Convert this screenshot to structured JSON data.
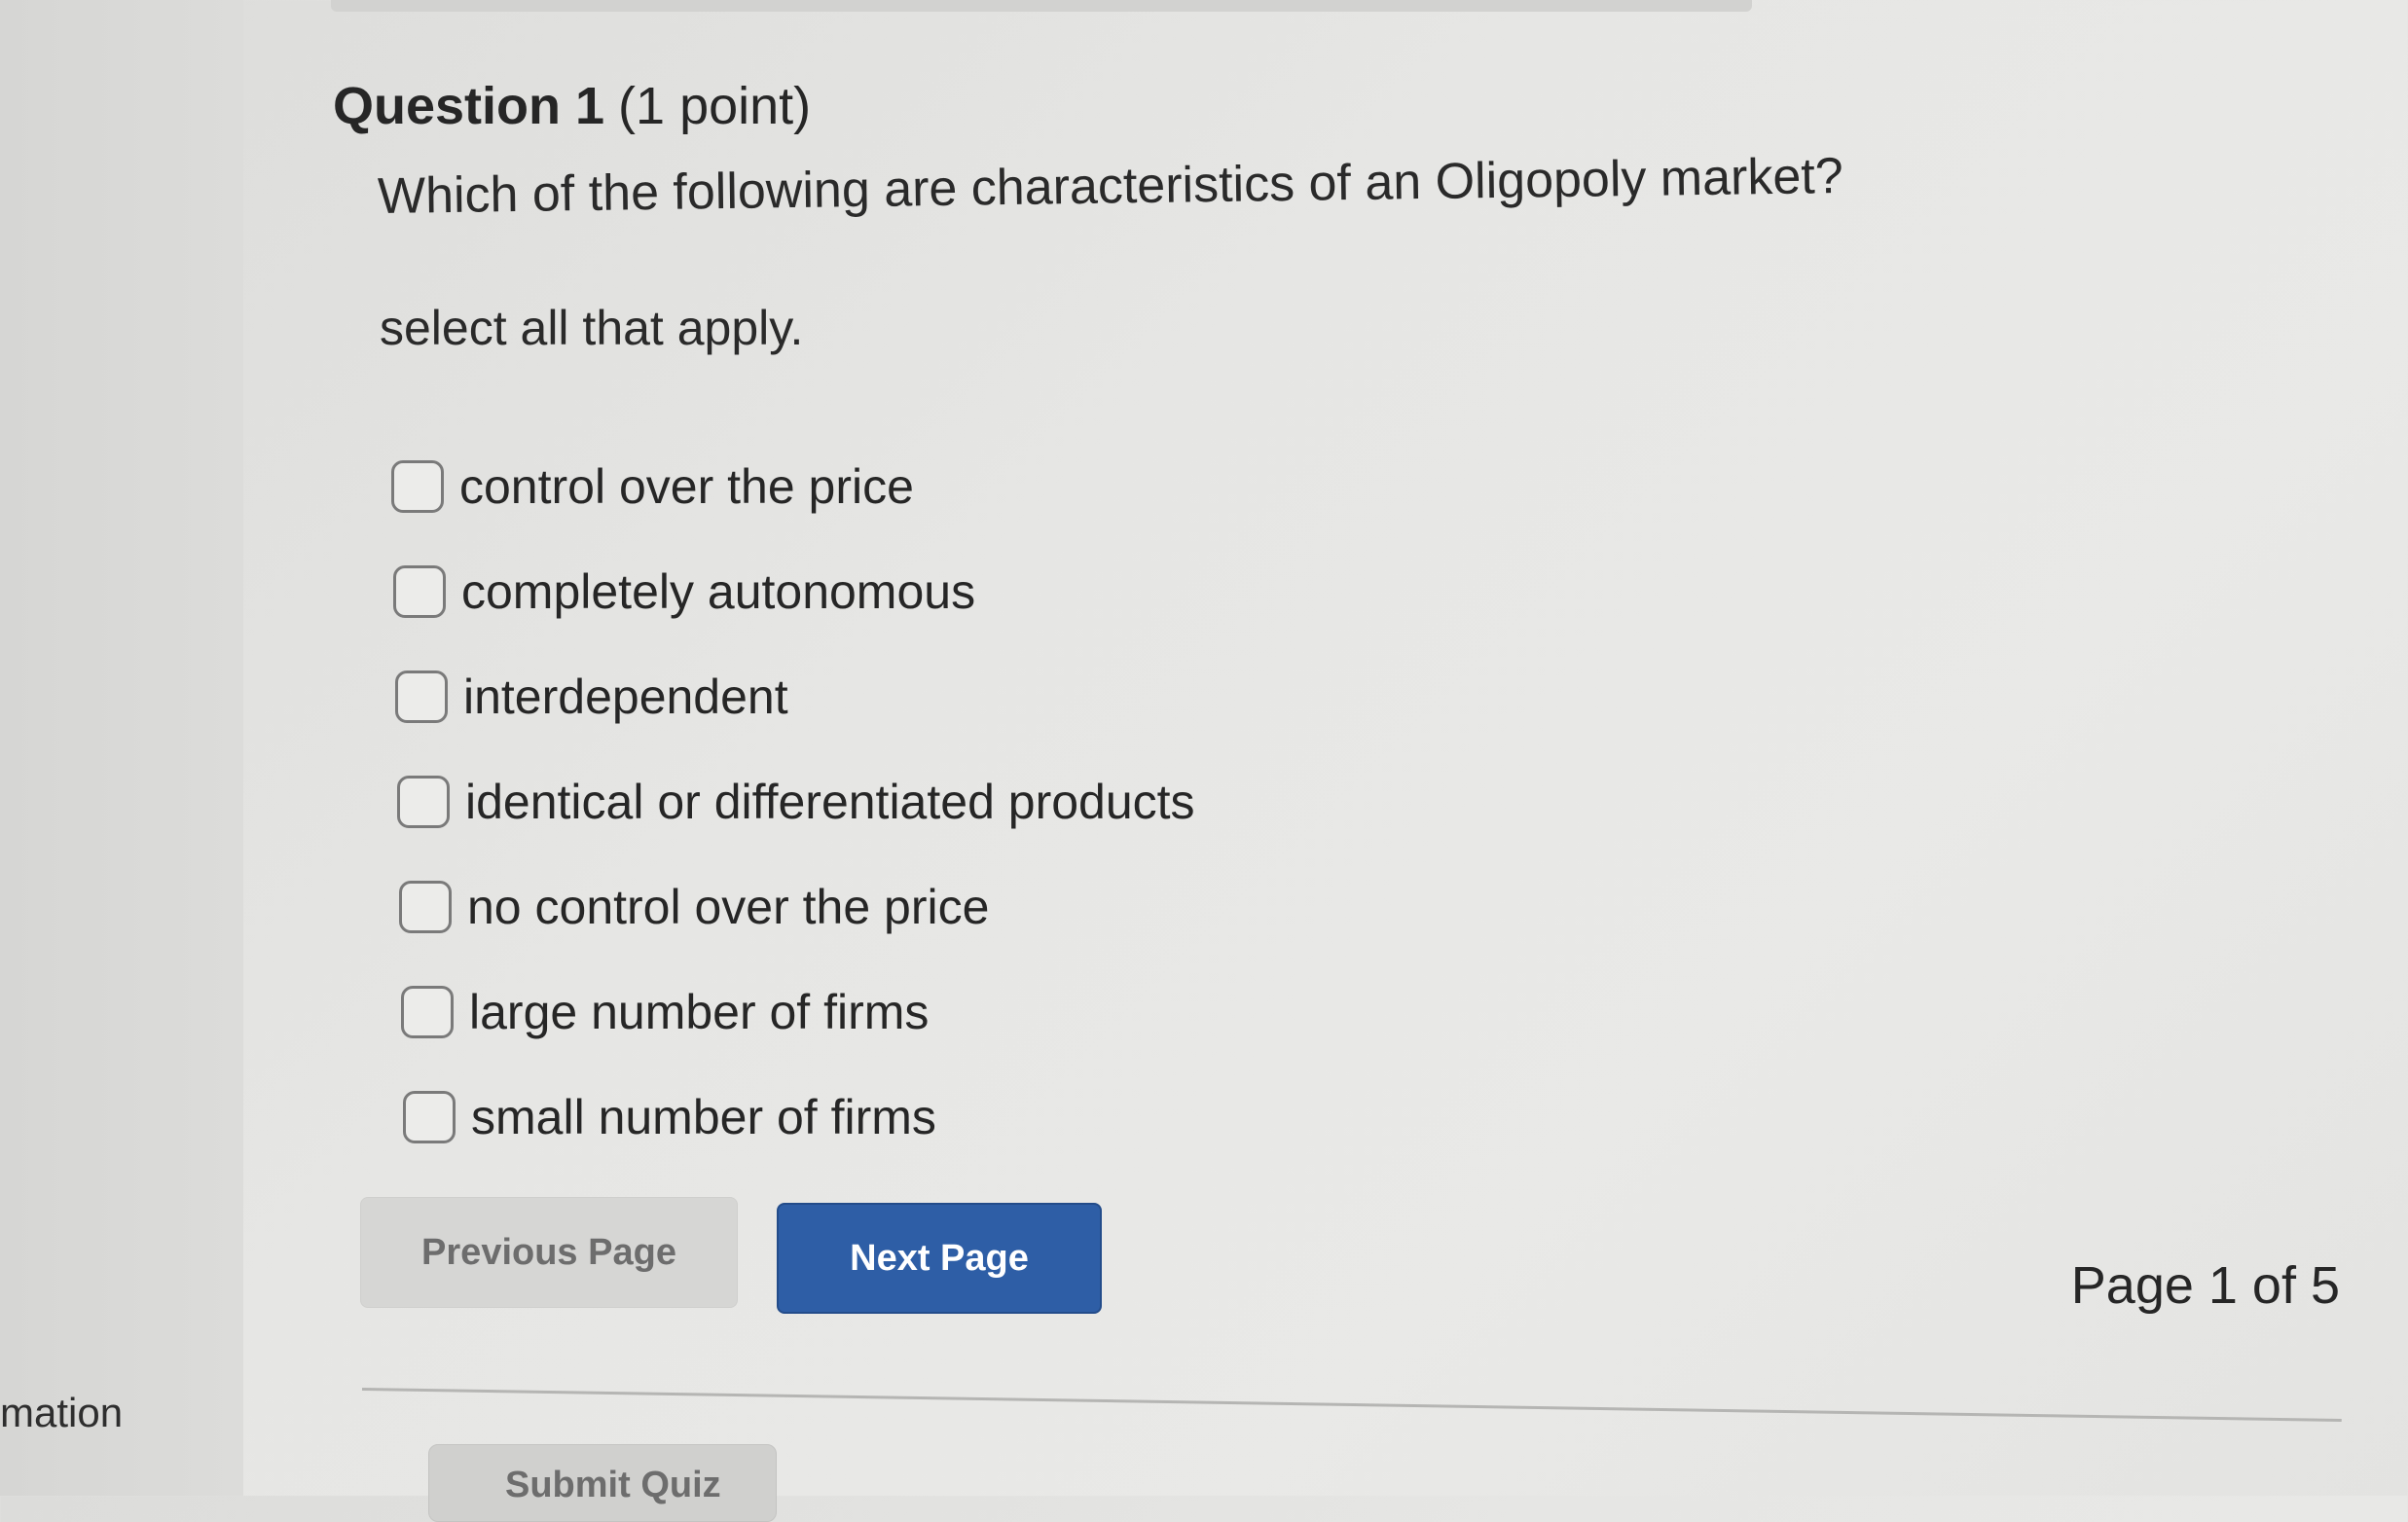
{
  "question": {
    "title": "Question 1",
    "points": "(1 point)",
    "text": "Which of the following are characteristics of an Oligopoly market?",
    "instruction": "select all that apply."
  },
  "options": [
    {
      "label": "control over the price",
      "checked": false
    },
    {
      "label": "completely autonomous",
      "checked": false
    },
    {
      "label": "interdependent",
      "checked": false
    },
    {
      "label": "identical or differentiated products",
      "checked": false
    },
    {
      "label": "no control over the price",
      "checked": false
    },
    {
      "label": "large number of firms",
      "checked": false
    },
    {
      "label": "small number of firms",
      "checked": false
    }
  ],
  "navigation": {
    "previous_label": "Previous Page",
    "next_label": "Next Page",
    "page_indicator": "Page 1 of 5"
  },
  "sidebar": {
    "partial_text": "rmation"
  },
  "footer": {
    "submit_label": "Submit Quiz"
  },
  "colors": {
    "primary_button": "#2e5ea6",
    "secondary_button": "#d6d6d4",
    "background": "#e6e6e4"
  }
}
